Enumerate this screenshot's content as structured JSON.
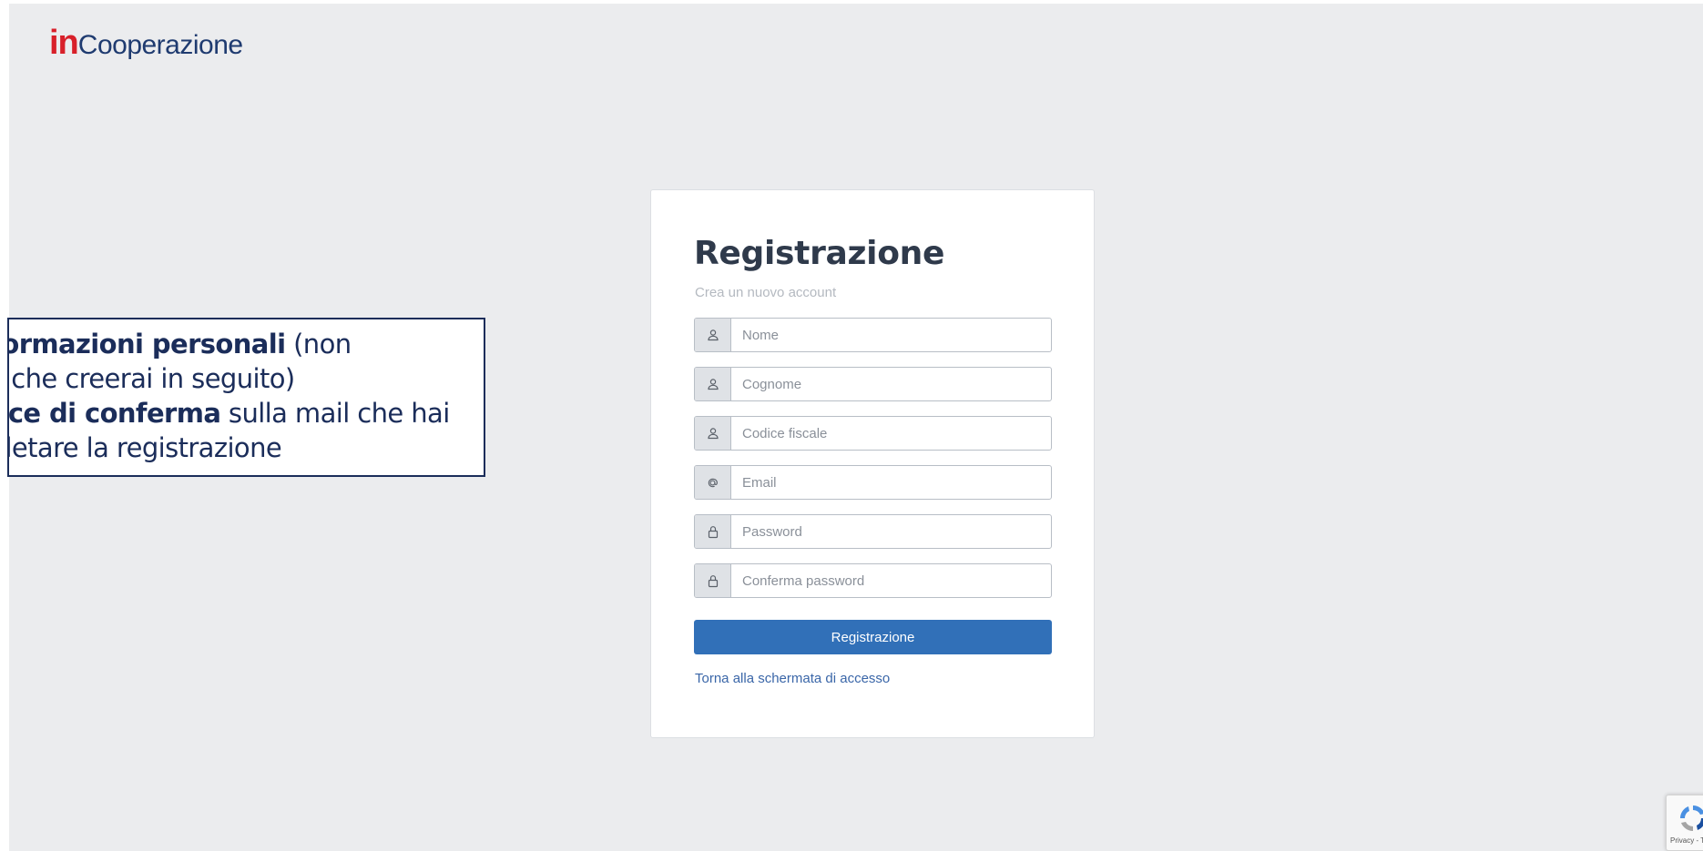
{
  "logo": {
    "part1": "in",
    "part2": "Cooperazione"
  },
  "callout": {
    "line1_bold": "informazioni personali",
    "line1_rest": " (non",
    "line2": "ne, che creerai in seguito)",
    "line3_bold": "odice di conferma",
    "line3_rest": " sulla mail che hai",
    "line4": "mpletare la registrazione"
  },
  "form": {
    "title": "Registrazione",
    "subtitle": "Crea un nuovo account",
    "fields": [
      {
        "placeholder": "Nome",
        "icon": "user-icon"
      },
      {
        "placeholder": "Cognome",
        "icon": "user-icon"
      },
      {
        "placeholder": "Codice fiscale",
        "icon": "user-icon"
      },
      {
        "placeholder": "Email",
        "icon": "at-icon"
      },
      {
        "placeholder": "Password",
        "icon": "lock-icon"
      },
      {
        "placeholder": "Conferma password",
        "icon": "lock-icon"
      }
    ],
    "submit_label": "Registrazione",
    "back_link": "Torna alla schermata di accesso"
  },
  "recaptcha": {
    "links": "Privacy - Termini"
  },
  "colors": {
    "brand_red": "#d8202a",
    "brand_navy": "#1f3b70",
    "button_blue": "#3170b8"
  }
}
